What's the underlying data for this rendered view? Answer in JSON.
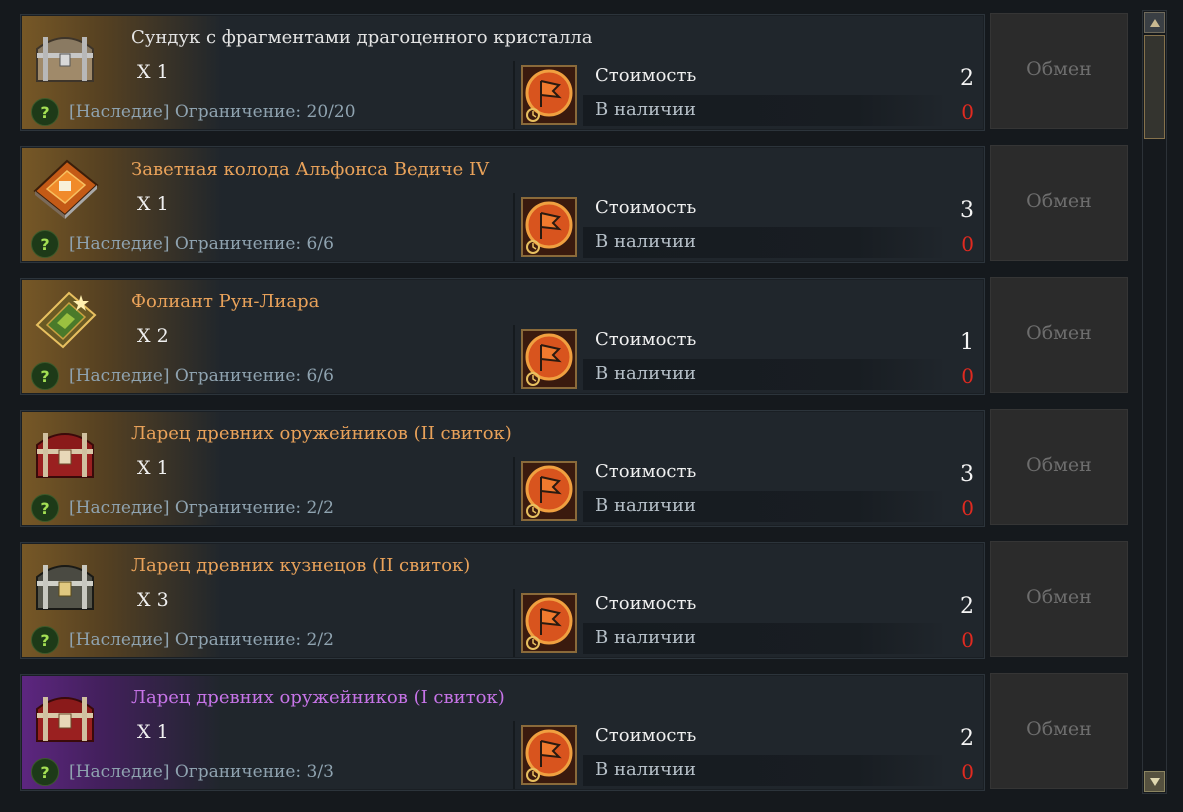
{
  "items": [
    {
      "name": "Сундук с фрагментами драгоценного кристалла",
      "qty": "X 1",
      "limit": "[Наследие] Ограничение: 20/20",
      "cost_label": "Стоимость",
      "cost": "2",
      "avail_label": "В наличии",
      "avail": "0",
      "exchange_label": "Обмен",
      "icon": "wooden-chest-icon",
      "rarity": "white"
    },
    {
      "name": "Заветная колода Альфонса Ведиче IV",
      "qty": "X 1",
      "limit": "[Наследие] Ограничение: 6/6",
      "cost_label": "Стоимость",
      "cost": "3",
      "avail_label": "В наличии",
      "avail": "0",
      "exchange_label": "Обмен",
      "icon": "card-deck-book-icon",
      "rarity": "orange"
    },
    {
      "name": "Фолиант Рун-Лиара",
      "qty": "X 2",
      "limit": "[Наследие] Ограничение: 6/6",
      "cost_label": "Стоимость",
      "cost": "1",
      "avail_label": "В наличии",
      "avail": "0",
      "exchange_label": "Обмен",
      "icon": "folio-book-icon",
      "rarity": "orange"
    },
    {
      "name": "Ларец древних оружейников (II свиток)",
      "qty": "X 1",
      "limit": "[Наследие] Ограничение: 2/2",
      "cost_label": "Стоимость",
      "cost": "3",
      "avail_label": "В наличии",
      "avail": "0",
      "exchange_label": "Обмен",
      "icon": "red-chest-icon",
      "rarity": "orange"
    },
    {
      "name": "Ларец древних кузнецов (II свиток)",
      "qty": "X 3",
      "limit": "[Наследие] Ограничение: 2/2",
      "cost_label": "Стоимость",
      "cost": "2",
      "avail_label": "В наличии",
      "avail": "0",
      "exchange_label": "Обмен",
      "icon": "silver-chest-icon",
      "rarity": "orange"
    },
    {
      "name": "Ларец древних оружейников (I свиток)",
      "qty": "X 1",
      "limit": "[Наследие] Ограничение: 3/3",
      "cost_label": "Стоимость",
      "cost": "2",
      "avail_label": "В наличии",
      "avail": "0",
      "exchange_label": "Обмен",
      "icon": "red-chest-icon",
      "rarity": "purple"
    }
  ],
  "help_glyph": "?",
  "currency_icon": "red-flag-token-icon",
  "colors": {
    "orange_name": "#e9a25a",
    "purple_name": "#c774e8",
    "white_name": "#e4e4e4",
    "avail_zero": "#e02a20",
    "help": "#a4e054"
  }
}
